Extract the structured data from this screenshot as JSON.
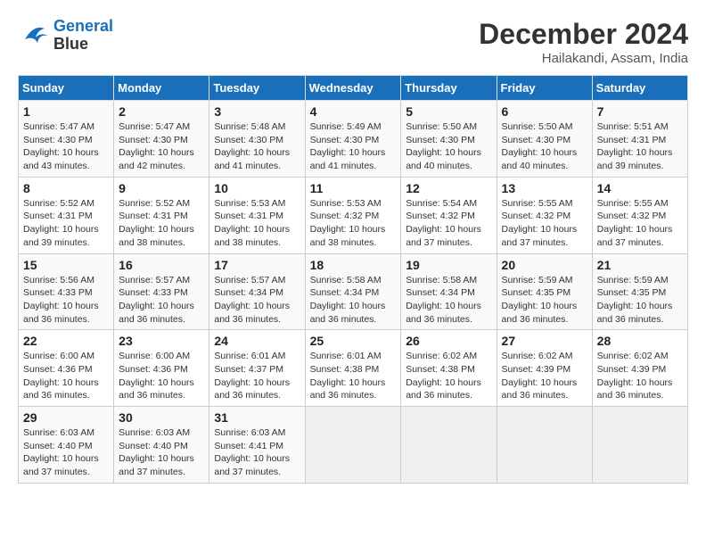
{
  "header": {
    "logo_line1": "General",
    "logo_line2": "Blue",
    "title": "December 2024",
    "subtitle": "Hailakandi, Assam, India"
  },
  "weekdays": [
    "Sunday",
    "Monday",
    "Tuesday",
    "Wednesday",
    "Thursday",
    "Friday",
    "Saturday"
  ],
  "weeks": [
    [
      {
        "day": "1",
        "sunrise": "5:47 AM",
        "sunset": "4:30 PM",
        "daylight": "10 hours and 43 minutes."
      },
      {
        "day": "2",
        "sunrise": "5:47 AM",
        "sunset": "4:30 PM",
        "daylight": "10 hours and 42 minutes."
      },
      {
        "day": "3",
        "sunrise": "5:48 AM",
        "sunset": "4:30 PM",
        "daylight": "10 hours and 41 minutes."
      },
      {
        "day": "4",
        "sunrise": "5:49 AM",
        "sunset": "4:30 PM",
        "daylight": "10 hours and 41 minutes."
      },
      {
        "day": "5",
        "sunrise": "5:50 AM",
        "sunset": "4:30 PM",
        "daylight": "10 hours and 40 minutes."
      },
      {
        "day": "6",
        "sunrise": "5:50 AM",
        "sunset": "4:30 PM",
        "daylight": "10 hours and 40 minutes."
      },
      {
        "day": "7",
        "sunrise": "5:51 AM",
        "sunset": "4:31 PM",
        "daylight": "10 hours and 39 minutes."
      }
    ],
    [
      {
        "day": "8",
        "sunrise": "5:52 AM",
        "sunset": "4:31 PM",
        "daylight": "10 hours and 39 minutes."
      },
      {
        "day": "9",
        "sunrise": "5:52 AM",
        "sunset": "4:31 PM",
        "daylight": "10 hours and 38 minutes."
      },
      {
        "day": "10",
        "sunrise": "5:53 AM",
        "sunset": "4:31 PM",
        "daylight": "10 hours and 38 minutes."
      },
      {
        "day": "11",
        "sunrise": "5:53 AM",
        "sunset": "4:32 PM",
        "daylight": "10 hours and 38 minutes."
      },
      {
        "day": "12",
        "sunrise": "5:54 AM",
        "sunset": "4:32 PM",
        "daylight": "10 hours and 37 minutes."
      },
      {
        "day": "13",
        "sunrise": "5:55 AM",
        "sunset": "4:32 PM",
        "daylight": "10 hours and 37 minutes."
      },
      {
        "day": "14",
        "sunrise": "5:55 AM",
        "sunset": "4:32 PM",
        "daylight": "10 hours and 37 minutes."
      }
    ],
    [
      {
        "day": "15",
        "sunrise": "5:56 AM",
        "sunset": "4:33 PM",
        "daylight": "10 hours and 36 minutes."
      },
      {
        "day": "16",
        "sunrise": "5:57 AM",
        "sunset": "4:33 PM",
        "daylight": "10 hours and 36 minutes."
      },
      {
        "day": "17",
        "sunrise": "5:57 AM",
        "sunset": "4:34 PM",
        "daylight": "10 hours and 36 minutes."
      },
      {
        "day": "18",
        "sunrise": "5:58 AM",
        "sunset": "4:34 PM",
        "daylight": "10 hours and 36 minutes."
      },
      {
        "day": "19",
        "sunrise": "5:58 AM",
        "sunset": "4:34 PM",
        "daylight": "10 hours and 36 minutes."
      },
      {
        "day": "20",
        "sunrise": "5:59 AM",
        "sunset": "4:35 PM",
        "daylight": "10 hours and 36 minutes."
      },
      {
        "day": "21",
        "sunrise": "5:59 AM",
        "sunset": "4:35 PM",
        "daylight": "10 hours and 36 minutes."
      }
    ],
    [
      {
        "day": "22",
        "sunrise": "6:00 AM",
        "sunset": "4:36 PM",
        "daylight": "10 hours and 36 minutes."
      },
      {
        "day": "23",
        "sunrise": "6:00 AM",
        "sunset": "4:36 PM",
        "daylight": "10 hours and 36 minutes."
      },
      {
        "day": "24",
        "sunrise": "6:01 AM",
        "sunset": "4:37 PM",
        "daylight": "10 hours and 36 minutes."
      },
      {
        "day": "25",
        "sunrise": "6:01 AM",
        "sunset": "4:38 PM",
        "daylight": "10 hours and 36 minutes."
      },
      {
        "day": "26",
        "sunrise": "6:02 AM",
        "sunset": "4:38 PM",
        "daylight": "10 hours and 36 minutes."
      },
      {
        "day": "27",
        "sunrise": "6:02 AM",
        "sunset": "4:39 PM",
        "daylight": "10 hours and 36 minutes."
      },
      {
        "day": "28",
        "sunrise": "6:02 AM",
        "sunset": "4:39 PM",
        "daylight": "10 hours and 36 minutes."
      }
    ],
    [
      {
        "day": "29",
        "sunrise": "6:03 AM",
        "sunset": "4:40 PM",
        "daylight": "10 hours and 37 minutes."
      },
      {
        "day": "30",
        "sunrise": "6:03 AM",
        "sunset": "4:40 PM",
        "daylight": "10 hours and 37 minutes."
      },
      {
        "day": "31",
        "sunrise": "6:03 AM",
        "sunset": "4:41 PM",
        "daylight": "10 hours and 37 minutes."
      },
      null,
      null,
      null,
      null
    ]
  ]
}
